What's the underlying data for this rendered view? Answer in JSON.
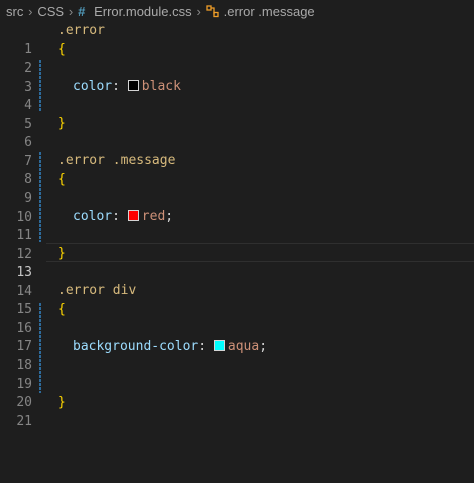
{
  "breadcrumb": {
    "items": [
      "src",
      "CSS",
      "Error.module.css",
      ".error .message"
    ],
    "separator": ">"
  },
  "editor": {
    "active_line": 13,
    "line_numbers": [
      "1",
      "2",
      "3",
      "4",
      "5",
      "6",
      "7",
      "8",
      "9",
      "10",
      "11",
      "12",
      "13",
      "14",
      "15",
      "16",
      "17",
      "18",
      "19",
      "20",
      "21"
    ],
    "blocks": [
      {
        "selector": ".error",
        "open": "{",
        "close": "}",
        "property": "color",
        "colon": ":",
        "value": "black",
        "semicolon": "",
        "swatch_color": "#000000"
      },
      {
        "selector": ".error .message",
        "open": "{",
        "close": "}",
        "property": "color",
        "colon": ":",
        "value": "red",
        "semicolon": ";",
        "swatch_color": "#ff0000"
      },
      {
        "selector": ".error div",
        "open": "{",
        "close": "}",
        "property": "background-color",
        "colon": ":",
        "value": "aqua",
        "semicolon": ";",
        "swatch_color": "#00ffff"
      }
    ]
  },
  "colors": {
    "background": "#1e1e1e",
    "selector": "#d7ba7d",
    "brace": "#ffd700",
    "property": "#9cdcfe",
    "value": "#ce9178",
    "line_number": "#858585",
    "modified_gutter": "#2d6a9a"
  },
  "icons": {
    "file": "css-hash-icon",
    "symbol": "css-selector-symbol-icon"
  }
}
